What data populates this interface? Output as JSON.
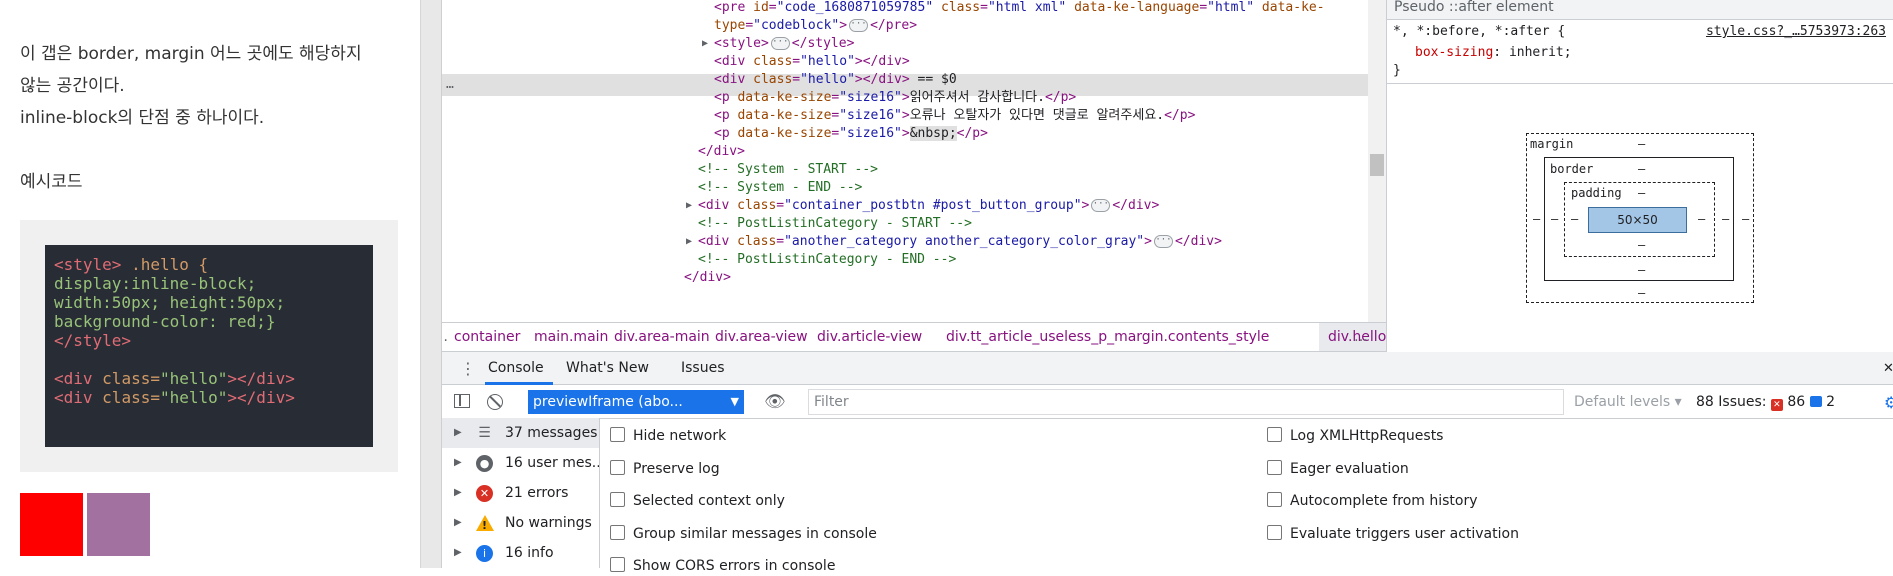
{
  "page": {
    "line1": "이 갭은 border, margin 어느 곳에도 해당하지",
    "line2": "않는 공간이다.",
    "line3": "inline-block의 단점 중 하나이다.",
    "code_heading": "예시코드",
    "code_lines": [
      [
        "<style>",
        " .hello {"
      ],
      [
        "display:inline-block;"
      ],
      [
        "width:50px; height:50px;"
      ],
      [
        "background-color: red;}"
      ],
      [
        "</style>"
      ],
      [
        ""
      ],
      [
        "<div ",
        "class=",
        "\"hello\"",
        "></div>"
      ],
      [
        "<div ",
        "class=",
        "\"hello\"",
        "></div>"
      ]
    ],
    "box_colors": [
      "#ff0000",
      "#a2719f"
    ]
  },
  "elements": {
    "lines": [
      {
        "indent": 714,
        "parts": [
          [
            "t",
            "<pre "
          ],
          [
            "an",
            "id"
          ],
          [
            "t",
            "="
          ],
          [
            "av",
            "\"code_1680871059785\""
          ],
          [
            "an",
            " class"
          ],
          [
            "t",
            "="
          ],
          [
            "av",
            "\"html xml\""
          ],
          [
            "an",
            " data-ke-language"
          ],
          [
            "t",
            "="
          ],
          [
            "av",
            "\"html\""
          ],
          [
            "an",
            " data-ke-"
          ]
        ]
      },
      {
        "indent": 714,
        "parts": [
          [
            "an",
            "type"
          ],
          [
            "t",
            "="
          ],
          [
            "av",
            "\"codeblock\""
          ],
          [
            "t",
            ">"
          ],
          [
            "e",
            ""
          ],
          [
            "t",
            "</pre>"
          ]
        ]
      },
      {
        "indent": 714,
        "tri": true,
        "parts": [
          [
            "t",
            "<style>"
          ],
          [
            "e",
            ""
          ],
          [
            "t",
            "</style>"
          ]
        ]
      },
      {
        "indent": 714,
        "parts": [
          [
            "t",
            "<div "
          ],
          [
            "an",
            "class"
          ],
          [
            "t",
            "="
          ],
          [
            "av",
            "\"hello\""
          ],
          [
            "t",
            "></div>"
          ]
        ]
      },
      {
        "indent": 714,
        "parts": [
          [
            "t",
            "<div "
          ],
          [
            "an",
            "class"
          ],
          [
            "t",
            "="
          ],
          [
            "av",
            "\"hello\""
          ],
          [
            "t",
            "></div>"
          ],
          [
            "tx",
            " == $0"
          ]
        ]
      },
      {
        "indent": 714,
        "parts": [
          [
            "t",
            "<p "
          ],
          [
            "an",
            "data-ke-size"
          ],
          [
            "t",
            "="
          ],
          [
            "av",
            "\"size16\""
          ],
          [
            "t",
            ">"
          ],
          [
            "tx",
            "읽어주셔서 감사합니다."
          ],
          [
            "t",
            "</p>"
          ]
        ]
      },
      {
        "indent": 714,
        "parts": [
          [
            "t",
            "<p "
          ],
          [
            "an",
            "data-ke-size"
          ],
          [
            "t",
            "="
          ],
          [
            "av",
            "\"size16\""
          ],
          [
            "t",
            ">"
          ],
          [
            "tx",
            "오류나 오탈자가 있다면 댓글로 알려주세요."
          ],
          [
            "t",
            "</p>"
          ]
        ]
      },
      {
        "indent": 714,
        "parts": [
          [
            "t",
            "<p "
          ],
          [
            "an",
            "data-ke-size"
          ],
          [
            "t",
            "="
          ],
          [
            "av",
            "\"size16\""
          ],
          [
            "t",
            ">"
          ],
          [
            "tx",
            "&nbsp;"
          ],
          [
            "t",
            "</p>"
          ]
        ]
      },
      {
        "indent": 698,
        "parts": [
          [
            "t",
            "</div>"
          ]
        ]
      },
      {
        "indent": 698,
        "parts": [
          [
            "cm",
            "<!-- System - START -->"
          ]
        ]
      },
      {
        "indent": 698,
        "parts": [
          [
            "cm",
            "<!-- System - END -->"
          ]
        ]
      },
      {
        "indent": 698,
        "tri": true,
        "parts": [
          [
            "t",
            "<div "
          ],
          [
            "an",
            "class"
          ],
          [
            "t",
            "="
          ],
          [
            "av",
            "\"container_postbtn #post_button_group\""
          ],
          [
            "t",
            ">"
          ],
          [
            "e",
            ""
          ],
          [
            "t",
            "</div>"
          ]
        ]
      },
      {
        "indent": 698,
        "parts": [
          [
            "cm",
            "<!-- PostListinCategory - START -->"
          ]
        ]
      },
      {
        "indent": 698,
        "tri": true,
        "parts": [
          [
            "t",
            "<div "
          ],
          [
            "an",
            "class"
          ],
          [
            "t",
            "="
          ],
          [
            "av",
            "\"another_category another_category_color_gray\""
          ],
          [
            "t",
            ">"
          ],
          [
            "e",
            ""
          ],
          [
            "t",
            "</div>"
          ]
        ]
      },
      {
        "indent": 698,
        "parts": [
          [
            "cm",
            "<!-- PostListinCategory - END -->"
          ]
        ]
      },
      {
        "indent": 684,
        "parts": [
          [
            "t",
            "</div>"
          ]
        ]
      }
    ],
    "row_dots": "…"
  },
  "breadcrumbs": {
    "more_left": "…",
    "items": [
      "container",
      "main.main",
      "div.area-main",
      "div.area-view",
      "div.article-view",
      "div.tt_article_useless_p_margin.contents_style",
      "div.hello"
    ],
    "more_right": "…"
  },
  "styles": {
    "header": "Pseudo ::after element",
    "selector": "*, *:before, *:after {",
    "source": "style.css?_…5753973:263",
    "prop_name": "box-sizing",
    "prop_value": "inherit;",
    "close": "}",
    "box_model": {
      "margin": "margin",
      "border": "border",
      "padding": "padding",
      "content": "50×50",
      "dash": "–"
    }
  },
  "tabs": {
    "items": [
      "Console",
      "What's New",
      "Issues"
    ],
    "close": "✕",
    "menu": "⋮"
  },
  "console_toolbar": {
    "context": "previewIframe (abo...",
    "filter_placeholder": "Filter",
    "levels": "Default levels ▾",
    "issues_label": "88 Issues:",
    "issues_errors": "86",
    "issues_info": "2"
  },
  "sidebar": {
    "items": [
      {
        "label": "37 messages",
        "icon": "list-icon"
      },
      {
        "label": "16 user mes...",
        "icon": "user-icon"
      },
      {
        "label": "21 errors",
        "icon": "error-icon",
        "color": "#d93025"
      },
      {
        "label": "No warnings",
        "icon": "warning-icon",
        "color": "#f9ab00"
      },
      {
        "label": "16 info",
        "icon": "info-icon",
        "color": "#1a73e8"
      }
    ]
  },
  "settings": {
    "left": [
      "Hide network",
      "Preserve log",
      "Selected context only",
      "Group similar messages in console",
      "Show CORS errors in console"
    ],
    "right": [
      "Log XMLHttpRequests",
      "Eager evaluation",
      "Autocomplete from history",
      "Evaluate triggers user activation"
    ]
  }
}
